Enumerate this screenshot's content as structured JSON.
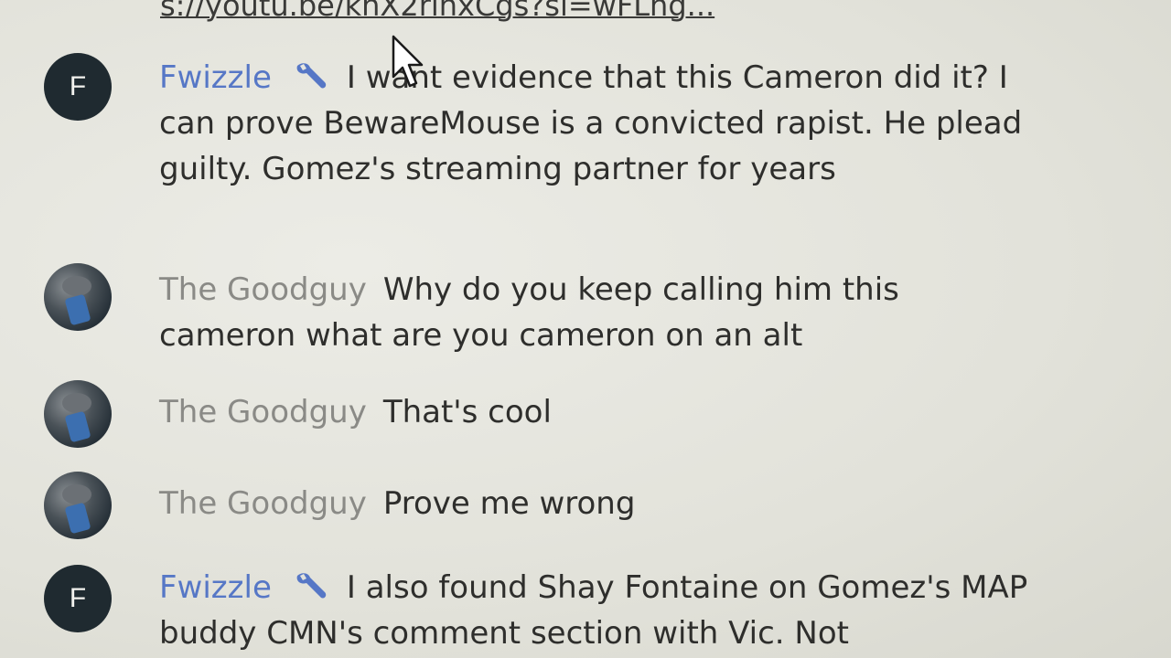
{
  "chat": {
    "top_link": "s://youtu.be/khX2rihxCgs?si=wFLng...",
    "messages": [
      {
        "avatar": "F",
        "author": "Fwizzle",
        "owner": true,
        "badge_icon": "wrench-icon",
        "text": "I want evidence that this Cameron did it? I can prove BewareMouse is a convicted rapist. He plead guilty. Gomez's streaming partner for years"
      },
      {
        "avatar": "",
        "author": "The Goodguy",
        "owner": false,
        "text": "Why do you keep calling him this cameron what are you cameron on an alt"
      },
      {
        "avatar": "",
        "author": "The Goodguy",
        "owner": false,
        "text": "That's cool"
      },
      {
        "avatar": "",
        "author": "The Goodguy",
        "owner": false,
        "text": "Prove me wrong"
      },
      {
        "avatar": "F",
        "author": "Fwizzle",
        "owner": true,
        "badge_icon": "wrench-icon",
        "text": "I also found Shay Fontaine on Gomez's MAP buddy CMN's comment section with Vic. Not"
      }
    ]
  },
  "colors": {
    "owner_name": "#5677c6",
    "guest_name": "#8a8a86",
    "text": "#2e2e2c",
    "avatar_letter_bg": "#1f2a30"
  }
}
